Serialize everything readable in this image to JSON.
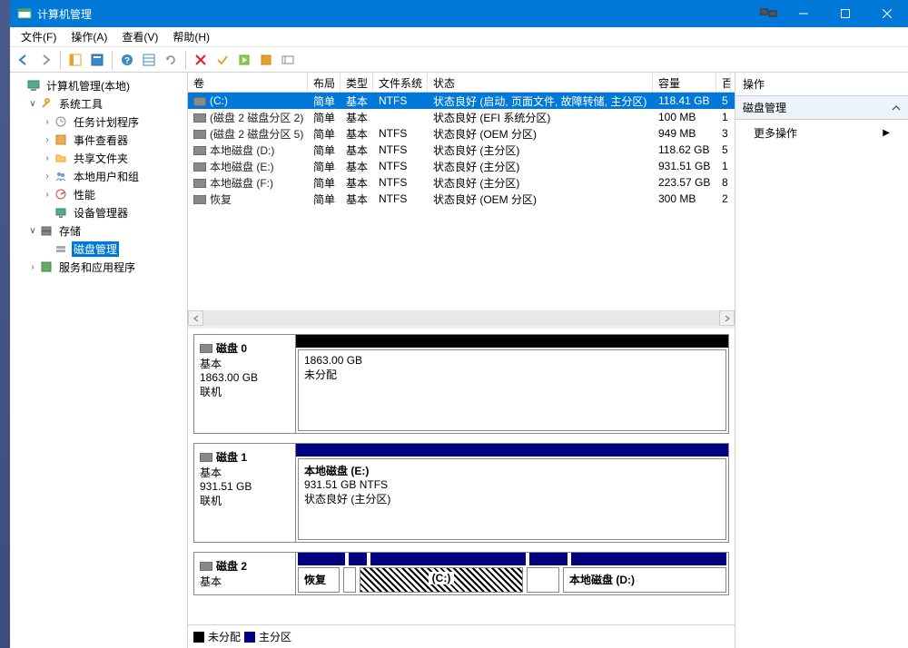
{
  "window": {
    "title": "计算机管理"
  },
  "menubar": [
    "文件(F)",
    "操作(A)",
    "查看(V)",
    "帮助(H)"
  ],
  "tree": {
    "root": "计算机管理(本地)",
    "sys_tools": "系统工具",
    "sys_tools_children": [
      "任务计划程序",
      "事件查看器",
      "共享文件夹",
      "本地用户和组",
      "性能",
      "设备管理器"
    ],
    "storage": "存储",
    "disk_mgmt": "磁盘管理",
    "services": "服务和应用程序"
  },
  "columns": {
    "vol": "卷",
    "layout": "布局",
    "type": "类型",
    "fs": "文件系统",
    "status": "状态",
    "capacity": "容量",
    "free": "百"
  },
  "volumes": [
    {
      "name": "(C:)",
      "layout": "简单",
      "type": "基本",
      "fs": "NTFS",
      "status": "状态良好 (启动, 页面文件, 故障转储, 主分区)",
      "capacity": "118.41 GB",
      "free": "5",
      "selected": true
    },
    {
      "name": "(磁盘 2 磁盘分区 2)",
      "layout": "简单",
      "type": "基本",
      "fs": "",
      "status": "状态良好 (EFI 系统分区)",
      "capacity": "100 MB",
      "free": "1"
    },
    {
      "name": "(磁盘 2 磁盘分区 5)",
      "layout": "简单",
      "type": "基本",
      "fs": "NTFS",
      "status": "状态良好 (OEM 分区)",
      "capacity": "949 MB",
      "free": "3"
    },
    {
      "name": "本地磁盘 (D:)",
      "layout": "简单",
      "type": "基本",
      "fs": "NTFS",
      "status": "状态良好 (主分区)",
      "capacity": "118.62 GB",
      "free": "5"
    },
    {
      "name": "本地磁盘 (E:)",
      "layout": "简单",
      "type": "基本",
      "fs": "NTFS",
      "status": "状态良好 (主分区)",
      "capacity": "931.51 GB",
      "free": "1"
    },
    {
      "name": "本地磁盘 (F:)",
      "layout": "简单",
      "type": "基本",
      "fs": "NTFS",
      "status": "状态良好 (主分区)",
      "capacity": "223.57 GB",
      "free": "8"
    },
    {
      "name": "恢复",
      "layout": "简单",
      "type": "基本",
      "fs": "NTFS",
      "status": "状态良好 (OEM 分区)",
      "capacity": "300 MB",
      "free": "2"
    }
  ],
  "disks": {
    "d0": {
      "title": "磁盘 0",
      "type": "基本",
      "size": "1863.00 GB",
      "status": "联机",
      "part": {
        "size": "1863.00 GB",
        "status": "未分配"
      }
    },
    "d1": {
      "title": "磁盘 1",
      "type": "基本",
      "size": "931.51 GB",
      "status": "联机",
      "part": {
        "title": "本地磁盘  (E:)",
        "size": "931.51 GB NTFS",
        "status": "状态良好 (主分区)"
      }
    },
    "d2": {
      "title": "磁盘 2",
      "type": "基本",
      "parts": {
        "p0": "恢复",
        "p1": "(C:)",
        "p2": "本地磁盘  (D:)"
      }
    }
  },
  "legend": {
    "unallocated": "未分配",
    "primary": "主分区"
  },
  "actions": {
    "header": "操作",
    "group": "磁盘管理",
    "more": "更多操作"
  }
}
